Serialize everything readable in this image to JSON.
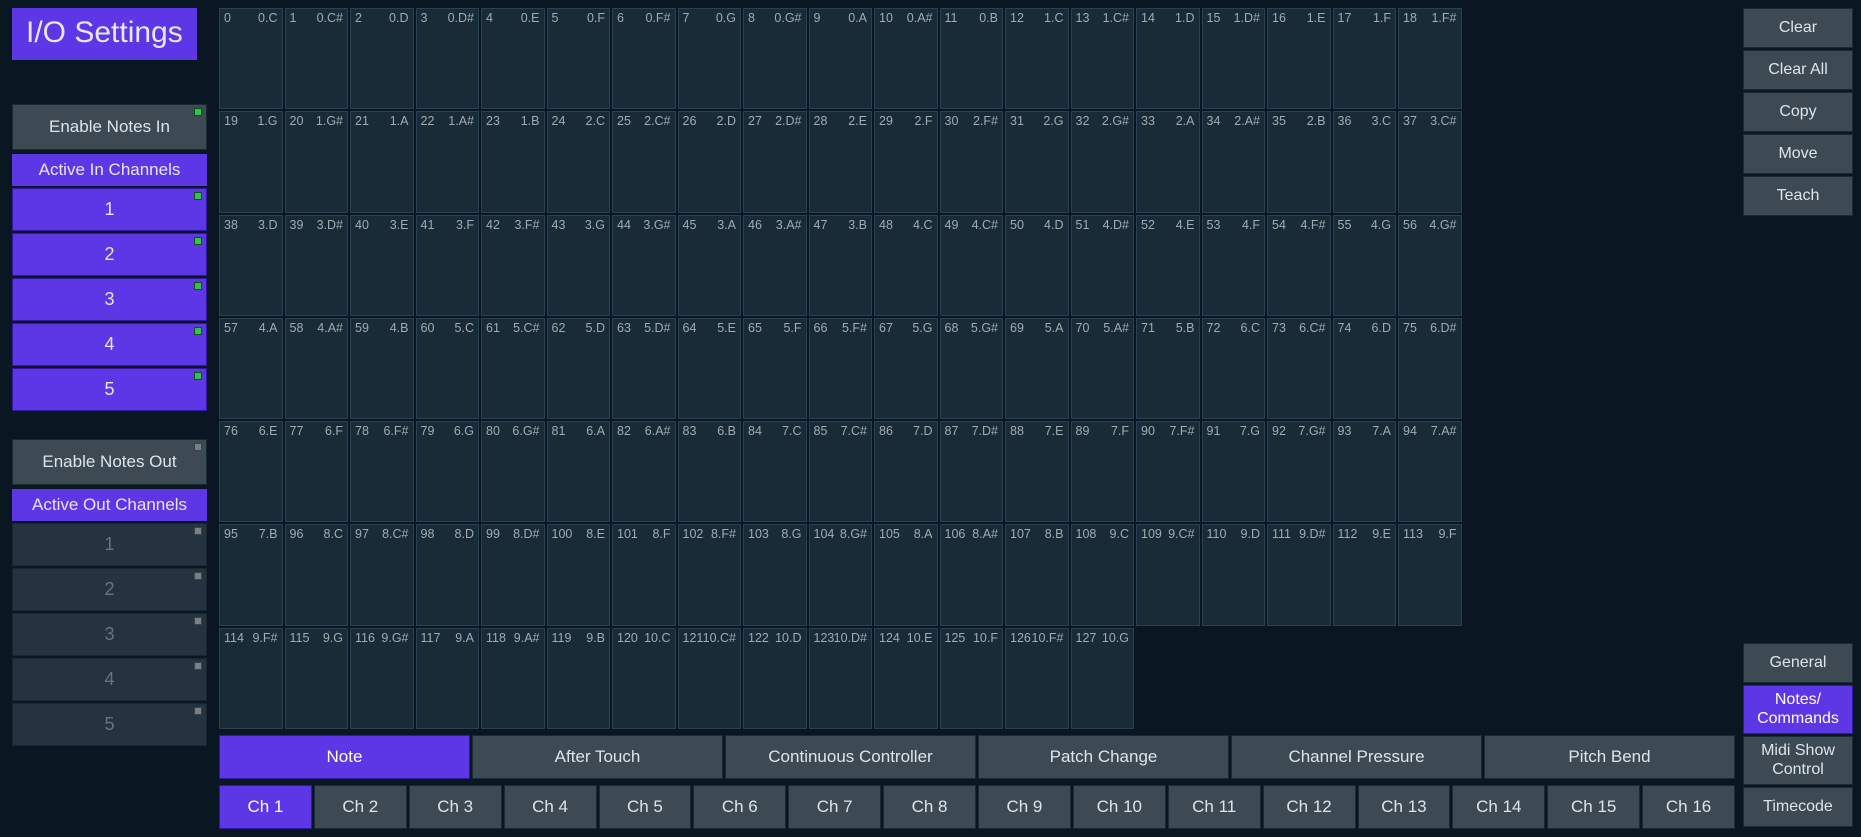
{
  "title": "I/O Settings",
  "enableNotesIn": {
    "label": "Enable Notes In",
    "on": true
  },
  "activeInHeader": "Active In Channels",
  "inChannels": [
    {
      "label": "1",
      "on": true
    },
    {
      "label": "2",
      "on": true
    },
    {
      "label": "3",
      "on": true
    },
    {
      "label": "4",
      "on": true
    },
    {
      "label": "5",
      "on": true
    }
  ],
  "enableNotesOut": {
    "label": "Enable Notes Out",
    "on": false
  },
  "activeOutHeader": "Active Out Channels",
  "outChannels": [
    {
      "label": "1",
      "on": false
    },
    {
      "label": "2",
      "on": false
    },
    {
      "label": "3",
      "on": false
    },
    {
      "label": "4",
      "on": false
    },
    {
      "label": "5",
      "on": false
    }
  ],
  "grid": [
    [
      {
        "n": "0",
        "nt": "0.C"
      },
      {
        "n": "1",
        "nt": "0.C#"
      },
      {
        "n": "2",
        "nt": "0.D"
      },
      {
        "n": "3",
        "nt": "0.D#"
      },
      {
        "n": "4",
        "nt": "0.E"
      },
      {
        "n": "5",
        "nt": "0.F"
      },
      {
        "n": "6",
        "nt": "0.F#"
      },
      {
        "n": "7",
        "nt": "0.G"
      },
      {
        "n": "8",
        "nt": "0.G#"
      },
      {
        "n": "9",
        "nt": "0.A"
      },
      {
        "n": "10",
        "nt": "0.A#"
      },
      {
        "n": "11",
        "nt": "0.B"
      },
      {
        "n": "12",
        "nt": "1.C"
      },
      {
        "n": "13",
        "nt": "1.C#"
      },
      {
        "n": "14",
        "nt": "1.D"
      },
      {
        "n": "15",
        "nt": "1.D#"
      },
      {
        "n": "16",
        "nt": "1.E"
      },
      {
        "n": "17",
        "nt": "1.F"
      },
      {
        "n": "18",
        "nt": "1.F#"
      }
    ],
    [
      {
        "n": "19",
        "nt": "1.G"
      },
      {
        "n": "20",
        "nt": "1.G#"
      },
      {
        "n": "21",
        "nt": "1.A"
      },
      {
        "n": "22",
        "nt": "1.A#"
      },
      {
        "n": "23",
        "nt": "1.B"
      },
      {
        "n": "24",
        "nt": "2.C"
      },
      {
        "n": "25",
        "nt": "2.C#"
      },
      {
        "n": "26",
        "nt": "2.D"
      },
      {
        "n": "27",
        "nt": "2.D#"
      },
      {
        "n": "28",
        "nt": "2.E"
      },
      {
        "n": "29",
        "nt": "2.F"
      },
      {
        "n": "30",
        "nt": "2.F#"
      },
      {
        "n": "31",
        "nt": "2.G"
      },
      {
        "n": "32",
        "nt": "2.G#"
      },
      {
        "n": "33",
        "nt": "2.A"
      },
      {
        "n": "34",
        "nt": "2.A#"
      },
      {
        "n": "35",
        "nt": "2.B"
      },
      {
        "n": "36",
        "nt": "3.C"
      },
      {
        "n": "37",
        "nt": "3.C#"
      }
    ],
    [
      {
        "n": "38",
        "nt": "3.D"
      },
      {
        "n": "39",
        "nt": "3.D#"
      },
      {
        "n": "40",
        "nt": "3.E"
      },
      {
        "n": "41",
        "nt": "3.F"
      },
      {
        "n": "42",
        "nt": "3.F#"
      },
      {
        "n": "43",
        "nt": "3.G"
      },
      {
        "n": "44",
        "nt": "3.G#"
      },
      {
        "n": "45",
        "nt": "3.A"
      },
      {
        "n": "46",
        "nt": "3.A#"
      },
      {
        "n": "47",
        "nt": "3.B"
      },
      {
        "n": "48",
        "nt": "4.C"
      },
      {
        "n": "49",
        "nt": "4.C#"
      },
      {
        "n": "50",
        "nt": "4.D"
      },
      {
        "n": "51",
        "nt": "4.D#"
      },
      {
        "n": "52",
        "nt": "4.E"
      },
      {
        "n": "53",
        "nt": "4.F"
      },
      {
        "n": "54",
        "nt": "4.F#"
      },
      {
        "n": "55",
        "nt": "4.G"
      },
      {
        "n": "56",
        "nt": "4.G#"
      }
    ],
    [
      {
        "n": "57",
        "nt": "4.A"
      },
      {
        "n": "58",
        "nt": "4.A#"
      },
      {
        "n": "59",
        "nt": "4.B"
      },
      {
        "n": "60",
        "nt": "5.C"
      },
      {
        "n": "61",
        "nt": "5.C#"
      },
      {
        "n": "62",
        "nt": "5.D"
      },
      {
        "n": "63",
        "nt": "5.D#"
      },
      {
        "n": "64",
        "nt": "5.E"
      },
      {
        "n": "65",
        "nt": "5.F"
      },
      {
        "n": "66",
        "nt": "5.F#"
      },
      {
        "n": "67",
        "nt": "5.G"
      },
      {
        "n": "68",
        "nt": "5.G#"
      },
      {
        "n": "69",
        "nt": "5.A"
      },
      {
        "n": "70",
        "nt": "5.A#"
      },
      {
        "n": "71",
        "nt": "5.B"
      },
      {
        "n": "72",
        "nt": "6.C"
      },
      {
        "n": "73",
        "nt": "6.C#"
      },
      {
        "n": "74",
        "nt": "6.D"
      },
      {
        "n": "75",
        "nt": "6.D#"
      }
    ],
    [
      {
        "n": "76",
        "nt": "6.E"
      },
      {
        "n": "77",
        "nt": "6.F"
      },
      {
        "n": "78",
        "nt": "6.F#"
      },
      {
        "n": "79",
        "nt": "6.G"
      },
      {
        "n": "80",
        "nt": "6.G#"
      },
      {
        "n": "81",
        "nt": "6.A"
      },
      {
        "n": "82",
        "nt": "6.A#"
      },
      {
        "n": "83",
        "nt": "6.B"
      },
      {
        "n": "84",
        "nt": "7.C"
      },
      {
        "n": "85",
        "nt": "7.C#"
      },
      {
        "n": "86",
        "nt": "7.D"
      },
      {
        "n": "87",
        "nt": "7.D#"
      },
      {
        "n": "88",
        "nt": "7.E"
      },
      {
        "n": "89",
        "nt": "7.F"
      },
      {
        "n": "90",
        "nt": "7.F#"
      },
      {
        "n": "91",
        "nt": "7.G"
      },
      {
        "n": "92",
        "nt": "7.G#"
      },
      {
        "n": "93",
        "nt": "7.A"
      },
      {
        "n": "94",
        "nt": "7.A#"
      }
    ],
    [
      {
        "n": "95",
        "nt": "7.B"
      },
      {
        "n": "96",
        "nt": "8.C"
      },
      {
        "n": "97",
        "nt": "8.C#"
      },
      {
        "n": "98",
        "nt": "8.D"
      },
      {
        "n": "99",
        "nt": "8.D#"
      },
      {
        "n": "100",
        "nt": "8.E"
      },
      {
        "n": "101",
        "nt": "8.F"
      },
      {
        "n": "102",
        "nt": "8.F#"
      },
      {
        "n": "103",
        "nt": "8.G"
      },
      {
        "n": "104",
        "nt": "8.G#"
      },
      {
        "n": "105",
        "nt": "8.A"
      },
      {
        "n": "106",
        "nt": "8.A#"
      },
      {
        "n": "107",
        "nt": "8.B"
      },
      {
        "n": "108",
        "nt": "9.C"
      },
      {
        "n": "109",
        "nt": "9.C#"
      },
      {
        "n": "110",
        "nt": "9.D"
      },
      {
        "n": "111",
        "nt": "9.D#"
      },
      {
        "n": "112",
        "nt": "9.E"
      },
      {
        "n": "113",
        "nt": "9.F"
      }
    ],
    [
      {
        "n": "114",
        "nt": "9.F#"
      },
      {
        "n": "115",
        "nt": "9.G"
      },
      {
        "n": "116",
        "nt": "9.G#"
      },
      {
        "n": "117",
        "nt": "9.A"
      },
      {
        "n": "118",
        "nt": "9.A#"
      },
      {
        "n": "119",
        "nt": "9.B"
      },
      {
        "n": "120",
        "nt": "10.C"
      },
      {
        "n": "121",
        "nt": "10.C#"
      },
      {
        "n": "122",
        "nt": "10.D"
      },
      {
        "n": "123",
        "nt": "10.D#"
      },
      {
        "n": "124",
        "nt": "10.E"
      },
      {
        "n": "125",
        "nt": "10.F"
      },
      {
        "n": "126",
        "nt": "10.F#"
      },
      {
        "n": "127",
        "nt": "10.G"
      }
    ]
  ],
  "typeTabs": [
    {
      "label": "Note",
      "active": true
    },
    {
      "label": "After Touch",
      "active": false
    },
    {
      "label": "Continuous Controller",
      "active": false
    },
    {
      "label": "Patch Change",
      "active": false
    },
    {
      "label": "Channel Pressure",
      "active": false
    },
    {
      "label": "Pitch Bend",
      "active": false
    }
  ],
  "chTabs": [
    {
      "label": "Ch 1",
      "active": true
    },
    {
      "label": "Ch 2",
      "active": false
    },
    {
      "label": "Ch 3",
      "active": false
    },
    {
      "label": "Ch 4",
      "active": false
    },
    {
      "label": "Ch 5",
      "active": false
    },
    {
      "label": "Ch 6",
      "active": false
    },
    {
      "label": "Ch 7",
      "active": false
    },
    {
      "label": "Ch 8",
      "active": false
    },
    {
      "label": "Ch 9",
      "active": false
    },
    {
      "label": "Ch 10",
      "active": false
    },
    {
      "label": "Ch 11",
      "active": false
    },
    {
      "label": "Ch 12",
      "active": false
    },
    {
      "label": "Ch 13",
      "active": false
    },
    {
      "label": "Ch 14",
      "active": false
    },
    {
      "label": "Ch 15",
      "active": false
    },
    {
      "label": "Ch 16",
      "active": false
    }
  ],
  "rightTop": [
    "Clear",
    "Clear All",
    "Copy",
    "Move",
    "Teach"
  ],
  "rightBottom": [
    {
      "label": "General",
      "active": false,
      "multi": false
    },
    {
      "label": "Notes/\nCommands",
      "active": true,
      "multi": true
    },
    {
      "label": "Midi Show\nControl",
      "active": false,
      "multi": true
    },
    {
      "label": "Timecode",
      "active": false,
      "multi": false
    }
  ]
}
